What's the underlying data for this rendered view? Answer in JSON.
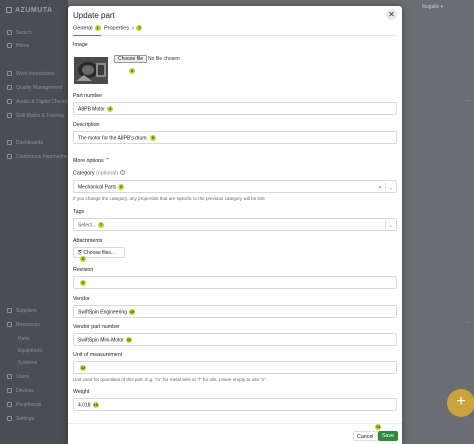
{
  "app": {
    "logo": "AZUMUTA",
    "user_label": "Ikugalle",
    "sidebar": [
      {
        "label": "Search"
      },
      {
        "label": "Home"
      },
      {
        "label": "Work Instructions"
      },
      {
        "label": "Quality Management"
      },
      {
        "label": "Audits & Digital Checklist"
      },
      {
        "label": "Skill Matrix & Training"
      },
      {
        "label": "Dashboards"
      },
      {
        "label": "Continuous Improvement"
      },
      {
        "label": "Suppliers"
      },
      {
        "label": "Resources"
      },
      {
        "label": "Parts"
      },
      {
        "label": "Equipment"
      },
      {
        "label": "Systems"
      },
      {
        "label": "Users"
      },
      {
        "label": "Devices"
      },
      {
        "label": "Peripherals"
      },
      {
        "label": "Settings"
      }
    ]
  },
  "modal": {
    "title": "Update part",
    "close_glyph": "✕",
    "tabs": {
      "general": "General",
      "general_badge": "1",
      "properties": "Properties",
      "properties_badge": "2"
    },
    "image": {
      "label": "Image",
      "choose_file": "Choose file",
      "no_file": "No file chosen",
      "badge": "3"
    },
    "part_number": {
      "label": "Part number",
      "value": "A8PB Motor",
      "badge": "4"
    },
    "description": {
      "label": "Description",
      "value": "The motor for the A8PB's drum.",
      "badge": "5"
    },
    "more_options": "More options",
    "category": {
      "label": "Category",
      "optional": "(optional)",
      "value": "Mechanical Parts",
      "badge": "6",
      "hint": "If you change the category, any properties that are specific to the previous category will be lost"
    },
    "tags": {
      "label": "Tags",
      "placeholder": "Select...",
      "badge": "7"
    },
    "attachments": {
      "label": "Attachments",
      "button": "Choose files...",
      "badge": "8"
    },
    "revision": {
      "label": "Revision",
      "value": "",
      "badge": "9"
    },
    "vendor": {
      "label": "Vendor",
      "value": "SwiftSpin Engineering",
      "badge": "10"
    },
    "vendor_part_number": {
      "label": "Vendor part number",
      "value": "SwiftSpin Mini-Motor",
      "badge": "11"
    },
    "unit_of_measurement": {
      "label": "Unit of measurement",
      "value": "",
      "badge": "12",
      "hint": "Unit used for quantities of this part. E.g. \"m\" for metal wire or \"l\" for oils. Leave empty to use \"x\"."
    },
    "weight": {
      "label": "Weight",
      "value": "4.018",
      "badge": "13"
    },
    "footer": {
      "cancel": "Cancel",
      "save": "Save",
      "save_badge": "14"
    }
  }
}
